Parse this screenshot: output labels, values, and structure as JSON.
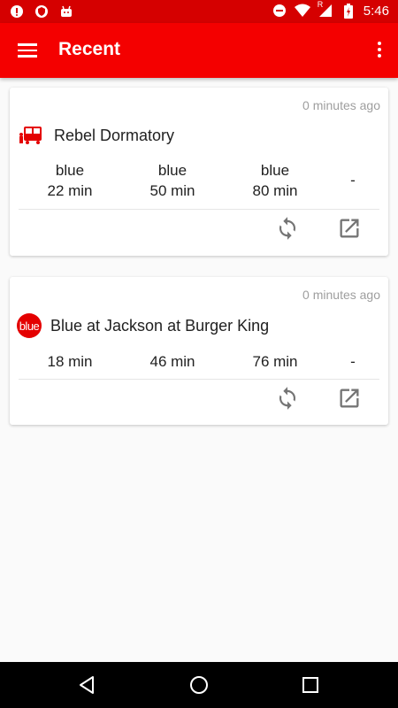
{
  "status_bar": {
    "time": "5:46",
    "icons": [
      "notification-icon",
      "shield-icon",
      "android-icon",
      "do-not-disturb-icon",
      "wifi-icon",
      "signal-icon",
      "battery-icon"
    ],
    "signal_label": "R"
  },
  "app_bar": {
    "title": "Recent",
    "color": "#f40000"
  },
  "cards": [
    {
      "updated": "0 minutes ago",
      "stop_name": "Rebel Dormatory",
      "icon": "bus-icon",
      "arrivals": [
        {
          "route": "blue",
          "time": "22 min"
        },
        {
          "route": "blue",
          "time": "50 min"
        },
        {
          "route": "blue",
          "time": "80 min"
        },
        {
          "route": "",
          "time": "-"
        }
      ]
    },
    {
      "updated": "0 minutes ago",
      "stop_name": "Blue at Jackson at Burger King",
      "badge": "blue",
      "arrivals": [
        {
          "time": "18 min"
        },
        {
          "time": "46 min"
        },
        {
          "time": "76 min"
        },
        {
          "time": "-"
        }
      ]
    }
  ],
  "accent_color": "#e40000",
  "nav": [
    "back-icon",
    "home-icon",
    "recents-icon"
  ]
}
